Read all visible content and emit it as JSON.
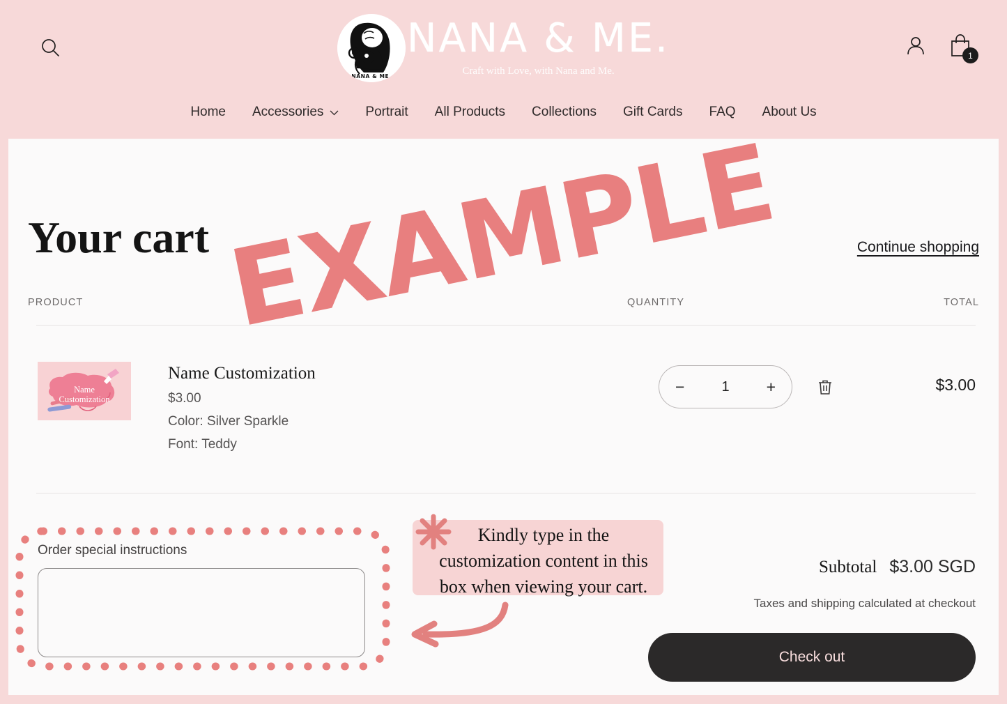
{
  "brand": {
    "wordmark": "NANA & ME.",
    "tagline": "Craft with Love, with Nana and Me.",
    "logo_badge_text": "NANA & ME."
  },
  "header": {
    "search_icon": "search-icon",
    "account_icon": "account-icon",
    "cart_icon": "shopping-bag-icon",
    "cart_count": "1",
    "nav": [
      {
        "label": "Home",
        "has_chevron": false
      },
      {
        "label": "Accessories",
        "has_chevron": true
      },
      {
        "label": "Portrait",
        "has_chevron": false
      },
      {
        "label": "All Products",
        "has_chevron": false
      },
      {
        "label": "Collections",
        "has_chevron": false
      },
      {
        "label": "Gift Cards",
        "has_chevron": false
      },
      {
        "label": "FAQ",
        "has_chevron": false
      },
      {
        "label": "About Us",
        "has_chevron": false
      }
    ]
  },
  "cart": {
    "title": "Your cart",
    "continue_link": "Continue shopping",
    "columns": {
      "product": "PRODUCT",
      "quantity": "QUANTITY",
      "total": "TOTAL"
    },
    "items": [
      {
        "thumbnail_text_line1": "Name",
        "thumbnail_text_line2": "Customization",
        "title": "Name Customization",
        "price": "$3.00",
        "option_color": "Color: Silver Sparkle",
        "option_font": "Font: Teddy",
        "decrease_label": "−",
        "quantity": "1",
        "increase_label": "+",
        "remove_icon": "trash-icon",
        "line_total": "$3.00"
      }
    ],
    "instructions": {
      "label": "Order special instructions",
      "value": "",
      "placeholder": ""
    },
    "summary": {
      "subtotal_label": "Subtotal",
      "subtotal_value": "$3.00 SGD",
      "tax_note": "Taxes and shipping calculated at checkout",
      "checkout_label": "Check out"
    }
  },
  "annotations": {
    "watermark": "EXAMPLE",
    "callout_line1": "Kindly type in the",
    "callout_line2": "customization content in this",
    "callout_line3": "box when viewing your cart.",
    "sparkle_icon": "sparkle-asterisk-icon",
    "arrow_icon": "curved-arrow-left-icon"
  },
  "colors": {
    "header_pink": "#f7d9d9",
    "content_bg": "#fbfafa",
    "accent_coral": "#e87f7f",
    "highlight_pink": "#f7d4d4",
    "checkout_dark": "#2b2929",
    "checkout_text": "#f9dede"
  }
}
